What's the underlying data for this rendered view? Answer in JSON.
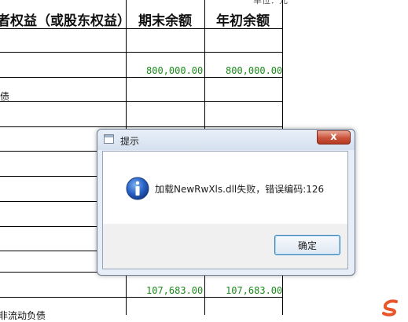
{
  "sheet": {
    "header_partial_note": "单位：元",
    "col_equity": "者权益（或股东权益）",
    "col_end": "期末余额",
    "col_begin": "年初余额",
    "row_values": {
      "row2_end": "800,000.00",
      "row2_begin": "800,000.00",
      "row_bottom_end": "107,683.00",
      "row_bottom_begin": "107,683.00"
    },
    "row_texts": {
      "debt_label": "债",
      "noncurrent_label": "非流动负债"
    }
  },
  "dialog": {
    "title": "提示",
    "message": "加载NewRwXls.dll失败，错误编码:126",
    "ok_label": "确定",
    "close_glyph": "x"
  }
}
